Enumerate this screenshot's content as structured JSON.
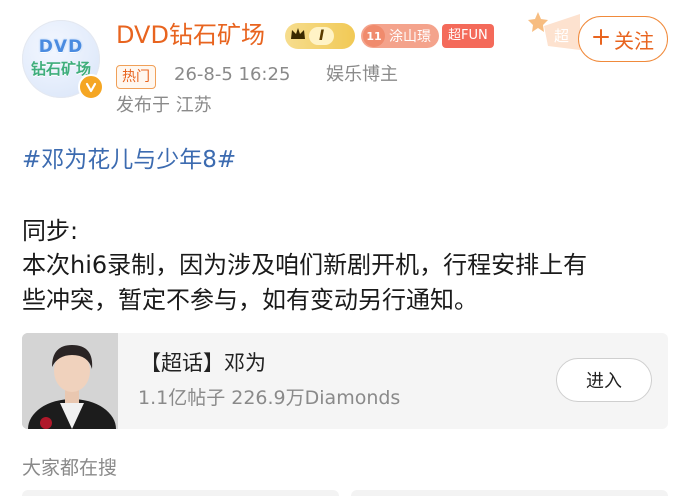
{
  "header": {
    "avatar_text_line1": "DVD",
    "avatar_text_line2": "钻石矿场",
    "username": "DVD钻石矿场",
    "vip_level": "I",
    "fan_level": "11",
    "fan_group": "涂山璟",
    "super_badge": "超FUN",
    "hot_tag": "热门",
    "timestamp": "26-8-5 16:25",
    "author_type": "娱乐博主",
    "location": "发布于 江苏",
    "follow_label": "关注",
    "follow_deco_text": "超"
  },
  "post": {
    "hashtag": "#邓为花儿与少年8#",
    "lines": [
      "同步:",
      "本次hi6录制，因为涉及咱们新剧开机，行程安排上有",
      "些冲突，暂定不参与，如有变动另行通知。"
    ]
  },
  "topic_card": {
    "title": "【超话】邓为",
    "stats": "1.1亿帖子 226.9万Diamonds",
    "enter_label": "进入"
  },
  "search": {
    "title": "大家都在搜"
  },
  "icons": {
    "avatar_badge": "v-verified-icon",
    "vip": "crown-icon",
    "fan": "diamond-icon",
    "follow": "plus-icon",
    "deco": "star-icon"
  },
  "colors": {
    "accent_orange": "#e8641f",
    "hashtag_blue": "#3c6bb0",
    "meta_gray": "#8a8a8a"
  }
}
